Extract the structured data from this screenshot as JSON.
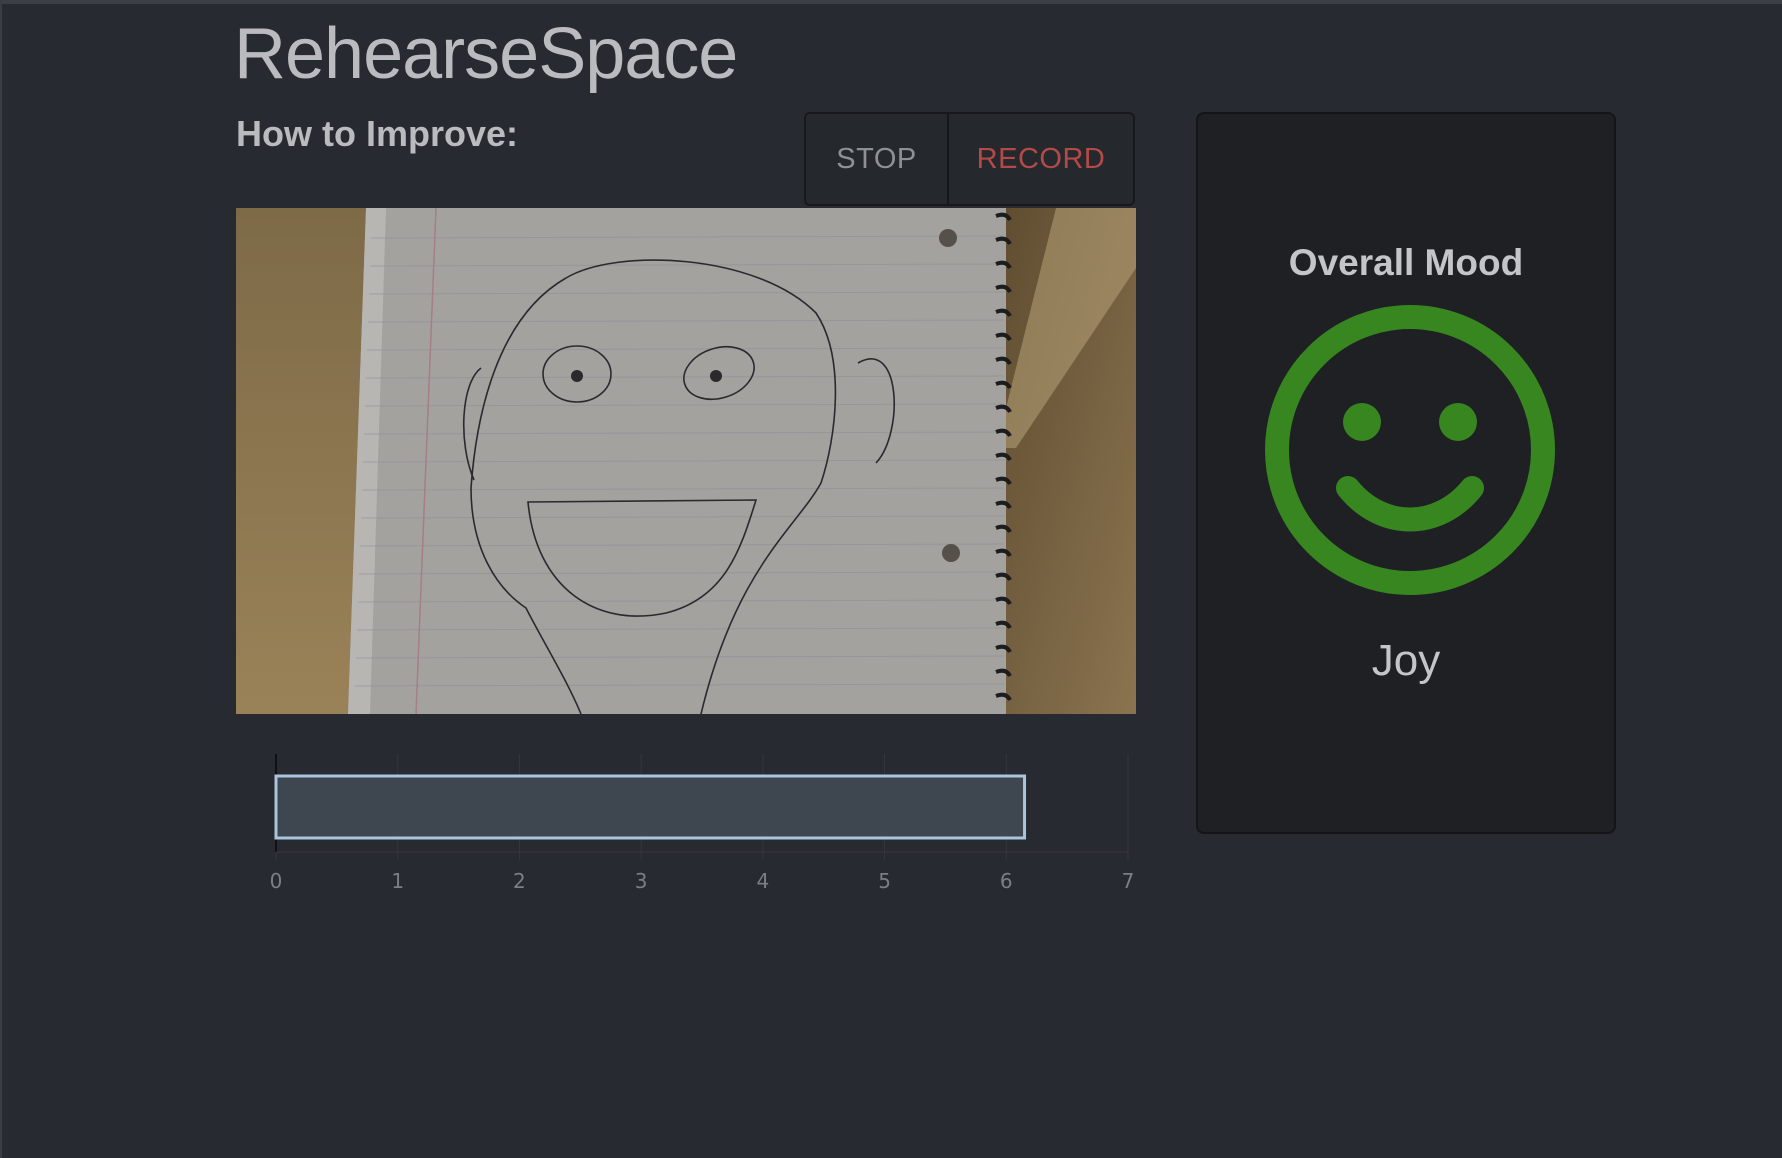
{
  "app": {
    "title": "RehearseSpace"
  },
  "feedback": {
    "heading": "How to Improve:"
  },
  "controls": {
    "stop_label": "STOP",
    "record_label": "RECORD"
  },
  "video": {
    "icon": "webcam-feed"
  },
  "mood": {
    "heading": "Overall Mood",
    "label": "Joy",
    "icon": "smiley-face-icon",
    "color": "#37861f"
  },
  "chart_data": {
    "type": "bar",
    "orientation": "horizontal",
    "values": [
      6.15
    ],
    "xlim": [
      0,
      7
    ],
    "ticks": [
      "0",
      "1",
      "2",
      "3",
      "4",
      "5",
      "6",
      "7"
    ],
    "grid": true,
    "bar_fill": "#3e4650",
    "bar_stroke": "#a9c6dc"
  },
  "colors": {
    "background": "#272a30",
    "record": "#b44a47",
    "stop": "#8d9095"
  }
}
